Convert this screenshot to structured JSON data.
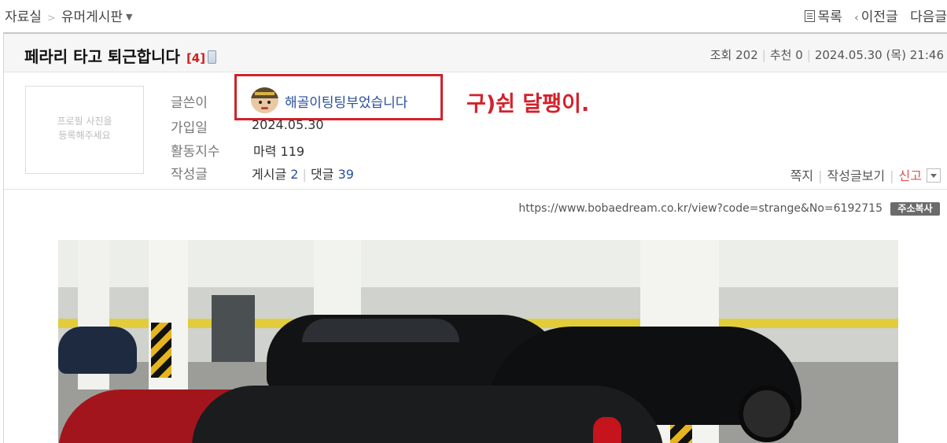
{
  "breadcrumb": {
    "home": "자료실",
    "separator": ">",
    "board": "유머게시판"
  },
  "topnav": {
    "list": "목록",
    "prev": "이전글",
    "next": "다음글"
  },
  "post": {
    "title": "페라리 타고 퇴근합니다",
    "comment_count": "[4]",
    "views_label": "조회",
    "views": "202",
    "recommend_label": "추천",
    "recommend": "0",
    "datetime": "2024.05.30 (목) 21:46"
  },
  "author": {
    "profile_placeholder_line1": "프로필 사진을",
    "profile_placeholder_line2": "등록해주세요",
    "writer_label": "글쓴이",
    "nickname": "해골이팅팅부었습니다",
    "joined_label": "가입일",
    "joined": "2024.05.30",
    "activity_label": "활동지수",
    "activity_name": "마력",
    "activity_value": "119",
    "posts_label": "작성글",
    "posts_name": "게시글",
    "posts_count": "2",
    "comments_name": "댓글",
    "comments_count": "39",
    "annotation": "구)쉰 달팽이."
  },
  "actions": {
    "message": "쪽지",
    "view_posts": "작성글보기",
    "report": "신고"
  },
  "url_bar": {
    "url": "https://www.bobaedream.co.kr/view?code=strange&No=6192715",
    "copy_label": "주소복사"
  },
  "colors": {
    "accent_red": "#d3212b",
    "link_blue": "#2a4f9c"
  },
  "icons": {
    "list": "list-icon",
    "prev": "chevron-left-icon",
    "dropdown": "caret-down-icon",
    "mobile": "mobile-icon"
  }
}
